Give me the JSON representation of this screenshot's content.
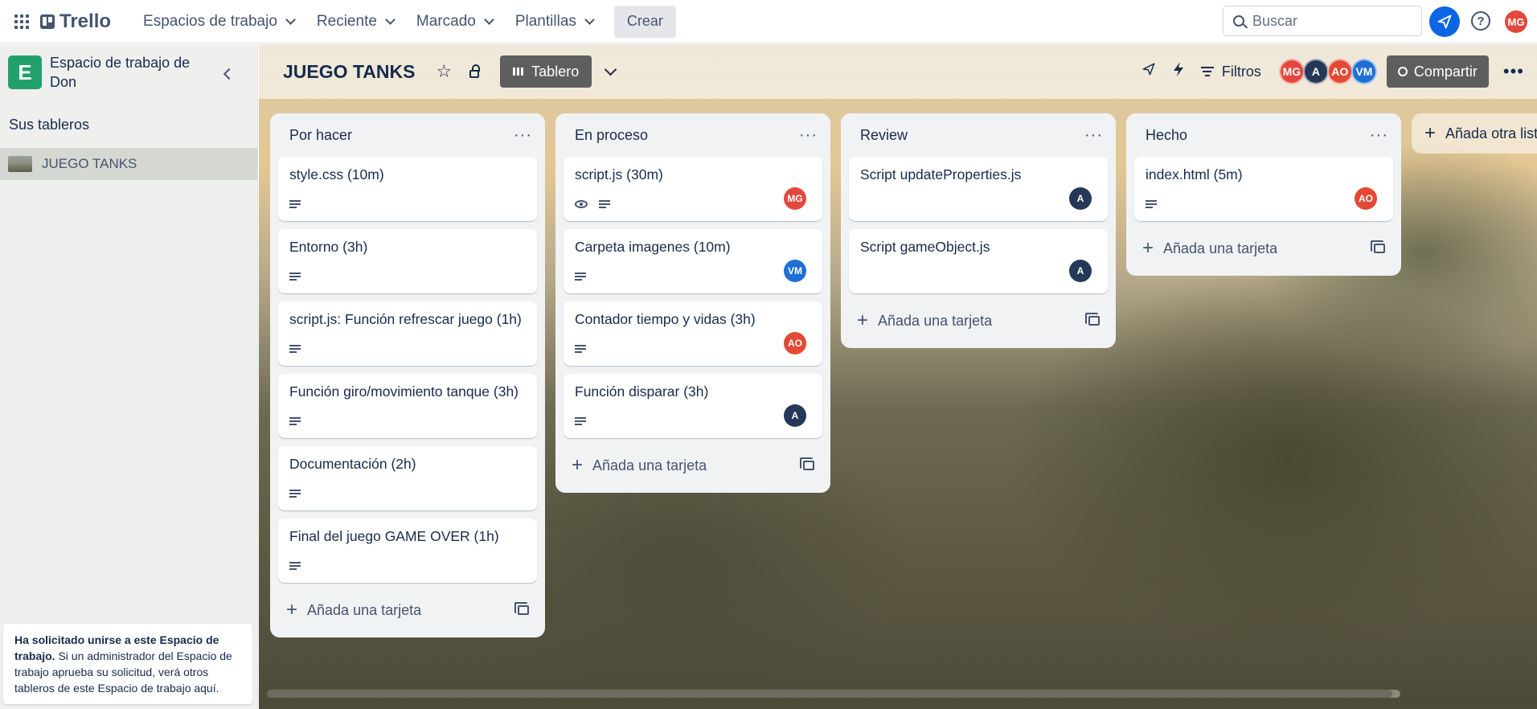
{
  "topbar": {
    "app_name": "Trello",
    "nav": [
      {
        "label": "Espacios de trabajo"
      },
      {
        "label": "Reciente"
      },
      {
        "label": "Marcado"
      },
      {
        "label": "Plantillas"
      }
    ],
    "create_label": "Crear",
    "search_placeholder": "Buscar",
    "help_glyph": "?",
    "user_initials": "MG",
    "icons": [
      "apps-grid-icon",
      "trello-logo-icon",
      "chevron-down-icon",
      "search-icon",
      "notification-icon",
      "help-icon"
    ]
  },
  "sidebar": {
    "workspace_initial": "E",
    "workspace_name": "Espacio de trabajo de Don",
    "boards_title": "Sus tableros",
    "boards": [
      {
        "name": "JUEGO TANKS"
      }
    ],
    "join_note": {
      "bold": "Ha solicitado unirse a este Espacio de trabajo.",
      "text": " Si un administrador del Espacio de trabajo aprueba su solicitud, verá otros tableros de este Espacio de trabajo aquí."
    }
  },
  "board": {
    "title": "JUEGO TANKS",
    "view_label": "Tablero",
    "filters_label": "Filtros",
    "share_label": "Compartir",
    "members": [
      {
        "initials": "MG",
        "color": "#e2483d"
      },
      {
        "initials": "A",
        "color": "#253858"
      },
      {
        "initials": "AO",
        "color": "#e34935"
      },
      {
        "initials": "VM",
        "color": "#1f6ed4"
      }
    ],
    "lists": [
      {
        "title": "Por hacer",
        "cards": [
          {
            "title": "style.css (10m)"
          },
          {
            "title": "Entorno (3h)"
          },
          {
            "title": "script.js: Función refrescar juego (1h)"
          },
          {
            "title": "Función giro/movimiento tanque (3h)"
          },
          {
            "title": "Documentación (2h)"
          },
          {
            "title": "Final del juego GAME OVER (1h)"
          }
        ],
        "add_label": "Añada una tarjeta"
      },
      {
        "title": "En proceso",
        "cards": [
          {
            "title": "script.js (30m)",
            "member": "MG",
            "member_color": "#e2483d",
            "watched": true
          },
          {
            "title": "Carpeta imagenes (10m)",
            "member": "VM",
            "member_color": "#1f6ed4"
          },
          {
            "title": "Contador tiempo y vidas (3h)",
            "member": "AO",
            "member_color": "#e34935"
          },
          {
            "title": "Función disparar (3h)",
            "member": "A",
            "member_color": "#253858"
          }
        ],
        "add_label": "Añada una tarjeta"
      },
      {
        "title": "Review",
        "cards": [
          {
            "title": "Script updateProperties.js",
            "member": "A",
            "member_color": "#253858"
          },
          {
            "title": "Script gameObject.js",
            "member": "A",
            "member_color": "#253858"
          }
        ],
        "add_label": "Añada una tarjeta"
      },
      {
        "title": "Hecho",
        "cards": [
          {
            "title": "index.html (5m)",
            "member": "AO",
            "member_color": "#e34935"
          }
        ],
        "add_label": "Añada una tarjeta"
      }
    ],
    "add_list_label": "Añada otra lista"
  }
}
